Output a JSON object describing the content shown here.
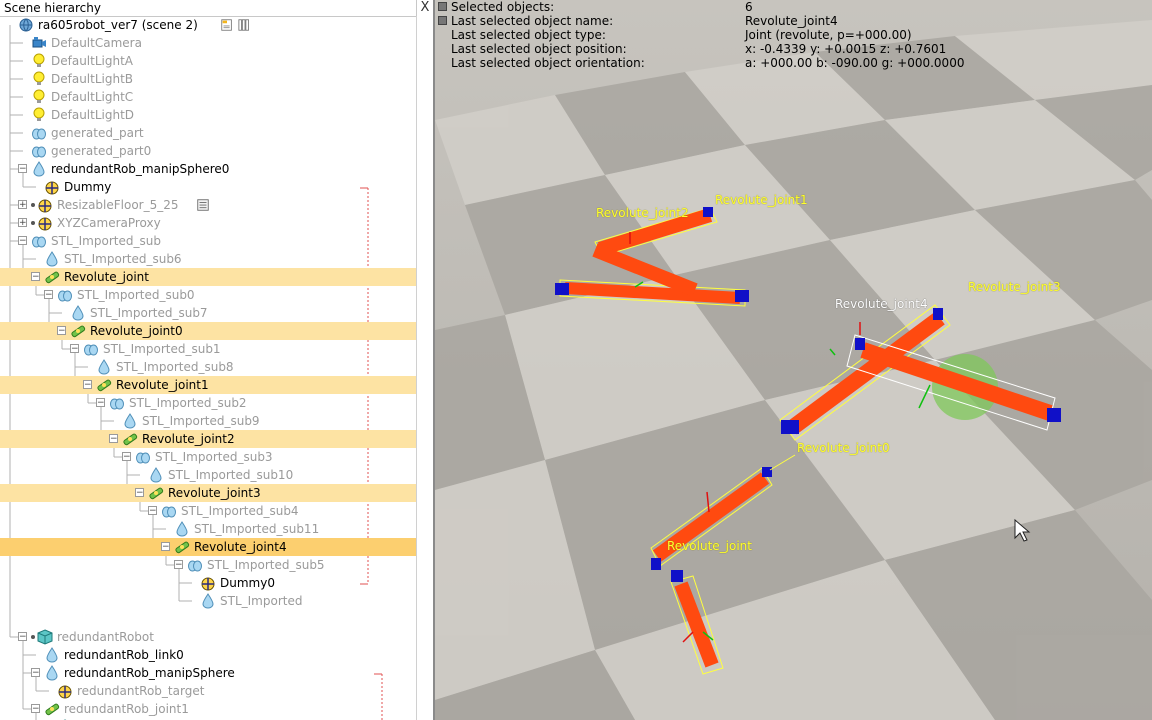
{
  "panel": {
    "title": "Scene hierarchy",
    "close_glyph": "X"
  },
  "tree": [
    {
      "label": "ra605robot_ver7 (scene 2)",
      "indent": 0,
      "icon": "scene-globe-icon",
      "style": "normal",
      "expander": null,
      "extra_icons": [
        "scene-page-icon",
        "scene-layers-icon"
      ]
    },
    {
      "label": "DefaultCamera",
      "indent": 1,
      "icon": "camera-icon",
      "style": "hidden"
    },
    {
      "label": "DefaultLightA",
      "indent": 1,
      "icon": "light-bulb-icon",
      "style": "hidden"
    },
    {
      "label": "DefaultLightB",
      "indent": 1,
      "icon": "light-bulb-icon",
      "style": "hidden"
    },
    {
      "label": "DefaultLightC",
      "indent": 1,
      "icon": "light-bulb-icon",
      "style": "hidden"
    },
    {
      "label": "DefaultLightD",
      "indent": 1,
      "icon": "light-bulb-icon",
      "style": "hidden"
    },
    {
      "label": "generated_part",
      "indent": 1,
      "icon": "compound-shape-icon",
      "style": "hidden"
    },
    {
      "label": "generated_part0",
      "indent": 1,
      "icon": "compound-shape-icon",
      "style": "hidden"
    },
    {
      "label": "redundantRob_manipSphere0",
      "indent": 1,
      "icon": "shape-drop-icon",
      "style": "normal",
      "expander": "minus"
    },
    {
      "label": "Dummy",
      "indent": 2,
      "icon": "dummy-icon",
      "style": "normal"
    },
    {
      "label": "ResizableFloor_5_25",
      "indent": 1,
      "icon": "dummy-icon",
      "style": "hidden",
      "expander": "plus",
      "dot": true,
      "extra_icons": [
        "script-icon"
      ]
    },
    {
      "label": "XYZCameraProxy",
      "indent": 1,
      "icon": "dummy-icon",
      "style": "hidden",
      "expander": "plus",
      "dot": true
    },
    {
      "label": "STL_Imported_sub",
      "indent": 1,
      "icon": "compound-shape-icon",
      "style": "hidden",
      "expander": "minus"
    },
    {
      "label": "STL_Imported_sub6",
      "indent": 2,
      "icon": "shape-drop-icon",
      "style": "hidden"
    },
    {
      "label": "Revolute_joint",
      "indent": 2,
      "icon": "joint-icon",
      "style": "normal",
      "expander": "minus",
      "selected": "sel"
    },
    {
      "label": "STL_Imported_sub0",
      "indent": 3,
      "icon": "compound-shape-icon",
      "style": "hidden",
      "expander": "minus"
    },
    {
      "label": "STL_Imported_sub7",
      "indent": 4,
      "icon": "shape-drop-icon",
      "style": "hidden"
    },
    {
      "label": "Revolute_joint0",
      "indent": 4,
      "icon": "joint-icon",
      "style": "normal",
      "expander": "minus",
      "selected": "sel"
    },
    {
      "label": "STL_Imported_sub1",
      "indent": 5,
      "icon": "compound-shape-icon",
      "style": "hidden",
      "expander": "minus"
    },
    {
      "label": "STL_Imported_sub8",
      "indent": 6,
      "icon": "shape-drop-icon",
      "style": "hidden"
    },
    {
      "label": "Revolute_joint1",
      "indent": 6,
      "icon": "joint-icon",
      "style": "normal",
      "expander": "minus",
      "selected": "sel"
    },
    {
      "label": "STL_Imported_sub2",
      "indent": 7,
      "icon": "compound-shape-icon",
      "style": "hidden",
      "expander": "minus"
    },
    {
      "label": "STL_Imported_sub9",
      "indent": 8,
      "icon": "shape-drop-icon",
      "style": "hidden"
    },
    {
      "label": "Revolute_joint2",
      "indent": 8,
      "icon": "joint-icon",
      "style": "normal",
      "expander": "minus",
      "selected": "sel"
    },
    {
      "label": "STL_Imported_sub3",
      "indent": 9,
      "icon": "compound-shape-icon",
      "style": "hidden",
      "expander": "minus"
    },
    {
      "label": "STL_Imported_sub10",
      "indent": 10,
      "icon": "shape-drop-icon",
      "style": "hidden"
    },
    {
      "label": "Revolute_joint3",
      "indent": 10,
      "icon": "joint-icon",
      "style": "normal",
      "expander": "minus",
      "selected": "sel"
    },
    {
      "label": "STL_Imported_sub4",
      "indent": 11,
      "icon": "compound-shape-icon",
      "style": "hidden",
      "expander": "minus"
    },
    {
      "label": "STL_Imported_sub11",
      "indent": 12,
      "icon": "shape-drop-icon",
      "style": "hidden"
    },
    {
      "label": "Revolute_joint4",
      "indent": 12,
      "icon": "joint-icon",
      "style": "normal",
      "expander": "minus",
      "selected": "sel-strong"
    },
    {
      "label": "STL_Imported_sub5",
      "indent": 13,
      "icon": "compound-shape-icon",
      "style": "hidden",
      "expander": "minus"
    },
    {
      "label": "Dummy0",
      "indent": 14,
      "icon": "dummy-icon",
      "style": "normal"
    },
    {
      "label": "STL_Imported",
      "indent": 14,
      "icon": "shape-drop-icon",
      "style": "hidden"
    },
    {
      "label": "",
      "indent": 0,
      "icon": null,
      "style": "hidden"
    },
    {
      "label": "redundantRobot",
      "indent": 1,
      "icon": "model-cube-icon",
      "style": "hidden",
      "expander": "minus",
      "dot": true
    },
    {
      "label": "redundantRob_link0",
      "indent": 2,
      "icon": "shape-drop-icon",
      "style": "normal"
    },
    {
      "label": "redundantRob_manipSphere",
      "indent": 2,
      "icon": "shape-drop-icon",
      "style": "normal",
      "expander": "minus"
    },
    {
      "label": "redundantRob_target",
      "indent": 3,
      "icon": "dummy-icon",
      "style": "hidden"
    },
    {
      "label": "redundantRob_joint1",
      "indent": 2,
      "icon": "joint-icon",
      "style": "hidden",
      "expander": "minus"
    },
    {
      "label": "Rectangle",
      "indent": 3,
      "icon": "model-cube-icon",
      "style": "hidden",
      "expander": "minus"
    }
  ],
  "info": {
    "rows": [
      {
        "label": "Selected objects:",
        "value": "6"
      },
      {
        "label": "Last selected object name:",
        "value": "Revolute_joint4"
      },
      {
        "label": "Last selected object type:",
        "value": "Joint (revolute, p=+000.00)"
      },
      {
        "label": "Last selected object position:",
        "value": "x: -0.4339    y: +0.0015    z: +0.7601"
      },
      {
        "label": "Last selected object orientation:",
        "value": "a: +000.00    b: -090.00    g: +000.0000"
      }
    ]
  },
  "viewport_labels": {
    "joint": "Revolute_joint",
    "joint0": "Revolute_joint0",
    "joint1": "Revolute_joint1",
    "joint2": "Revolute_joint2",
    "joint3": "Revolute_joint3",
    "joint4": "Revolute_joint4"
  },
  "colors": {
    "selection": "#fde3a3",
    "selection_strong": "#fccf6f",
    "hidden_text": "#9a9a9a",
    "link_orange": "#ff4a10",
    "joint_blue": "#1010c8",
    "label_yellow": "#ffff30",
    "floor_light": "#cfccc6",
    "floor_dark": "#aeaba5"
  }
}
